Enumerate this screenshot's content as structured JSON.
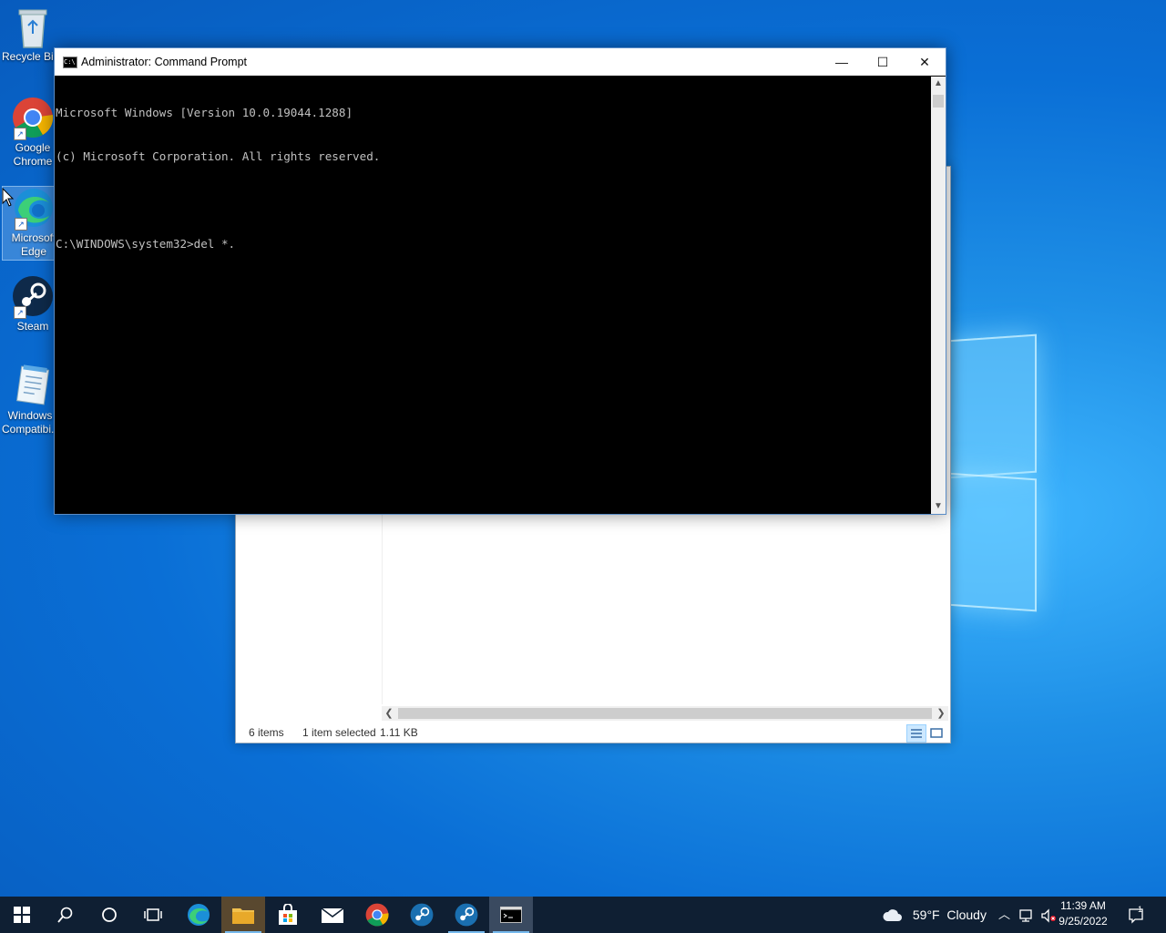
{
  "desktop": {
    "icons": [
      {
        "label": "Recycle Bin"
      },
      {
        "label": "Google Chrome"
      },
      {
        "label": "Microsoft Edge"
      },
      {
        "label": "Steam"
      },
      {
        "label": "Windows Compatibi..."
      }
    ]
  },
  "explorer": {
    "status_items": "6 items",
    "status_selected": "1 item selected",
    "status_size": "1.11 KB"
  },
  "cmd": {
    "title": "Administrator: Command Prompt",
    "lines": [
      "Microsoft Windows [Version 10.0.19044.1288]",
      "(c) Microsoft Corporation. All rights reserved.",
      "",
      "C:\\WINDOWS\\system32>del *."
    ],
    "minimize_glyph": "—",
    "maximize_glyph": "☐",
    "close_glyph": "✕"
  },
  "taskbar": {
    "items": [
      "start-icon",
      "search-icon",
      "cortana-icon",
      "task-view-icon",
      "edge-icon",
      "file-explorer-icon",
      "store-icon",
      "mail-icon",
      "chrome-icon",
      "steam-icon",
      "steam-icon",
      "cmd-icon"
    ],
    "weather": "59°F  Cloudy",
    "time": "11:39 AM",
    "date": "9/25/2022",
    "notification_count": "1"
  },
  "colors": {
    "taskbar": "#0f1f33",
    "console_bg": "#000000",
    "console_fg": "#c0c0c0",
    "accent": "#76b9ed"
  }
}
